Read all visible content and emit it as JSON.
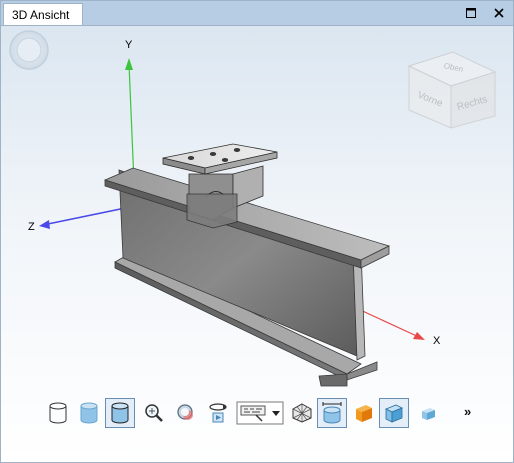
{
  "window": {
    "tab_label": "3D Ansicht",
    "maximize_icon": "maximize-icon",
    "close_icon": "close-icon"
  },
  "scene": {
    "axis_labels": {
      "x": "X",
      "y": "Y",
      "z": "Z"
    },
    "axis_colors": {
      "x": "#e84a4a",
      "y": "#3cc43c",
      "z": "#4a4ae8"
    },
    "view_cube": {
      "front_label": "Vorne",
      "right_label": "Rechts",
      "top_label": "Oben"
    },
    "navigation_icon": "navigation-wheel-icon"
  },
  "toolbar": {
    "items": [
      {
        "icon": "wireframe-cylinder-icon"
      },
      {
        "icon": "shaded-cylinder-icon"
      },
      {
        "icon": "shaded-edges-cylinder-icon",
        "active": true
      },
      {
        "icon": "zoom-icon"
      },
      {
        "icon": "zoom-all-icon"
      },
      {
        "icon": "rotate-view-icon"
      },
      {
        "icon": "display-options-dropdown-icon"
      },
      {
        "icon": "mesh-display-icon"
      },
      {
        "icon": "dimension-view-icon",
        "active": true
      },
      {
        "icon": "colored-part-icon"
      },
      {
        "icon": "part-view-icon",
        "active": true
      },
      {
        "icon": "box-view-icon"
      }
    ],
    "more_label": "»"
  }
}
